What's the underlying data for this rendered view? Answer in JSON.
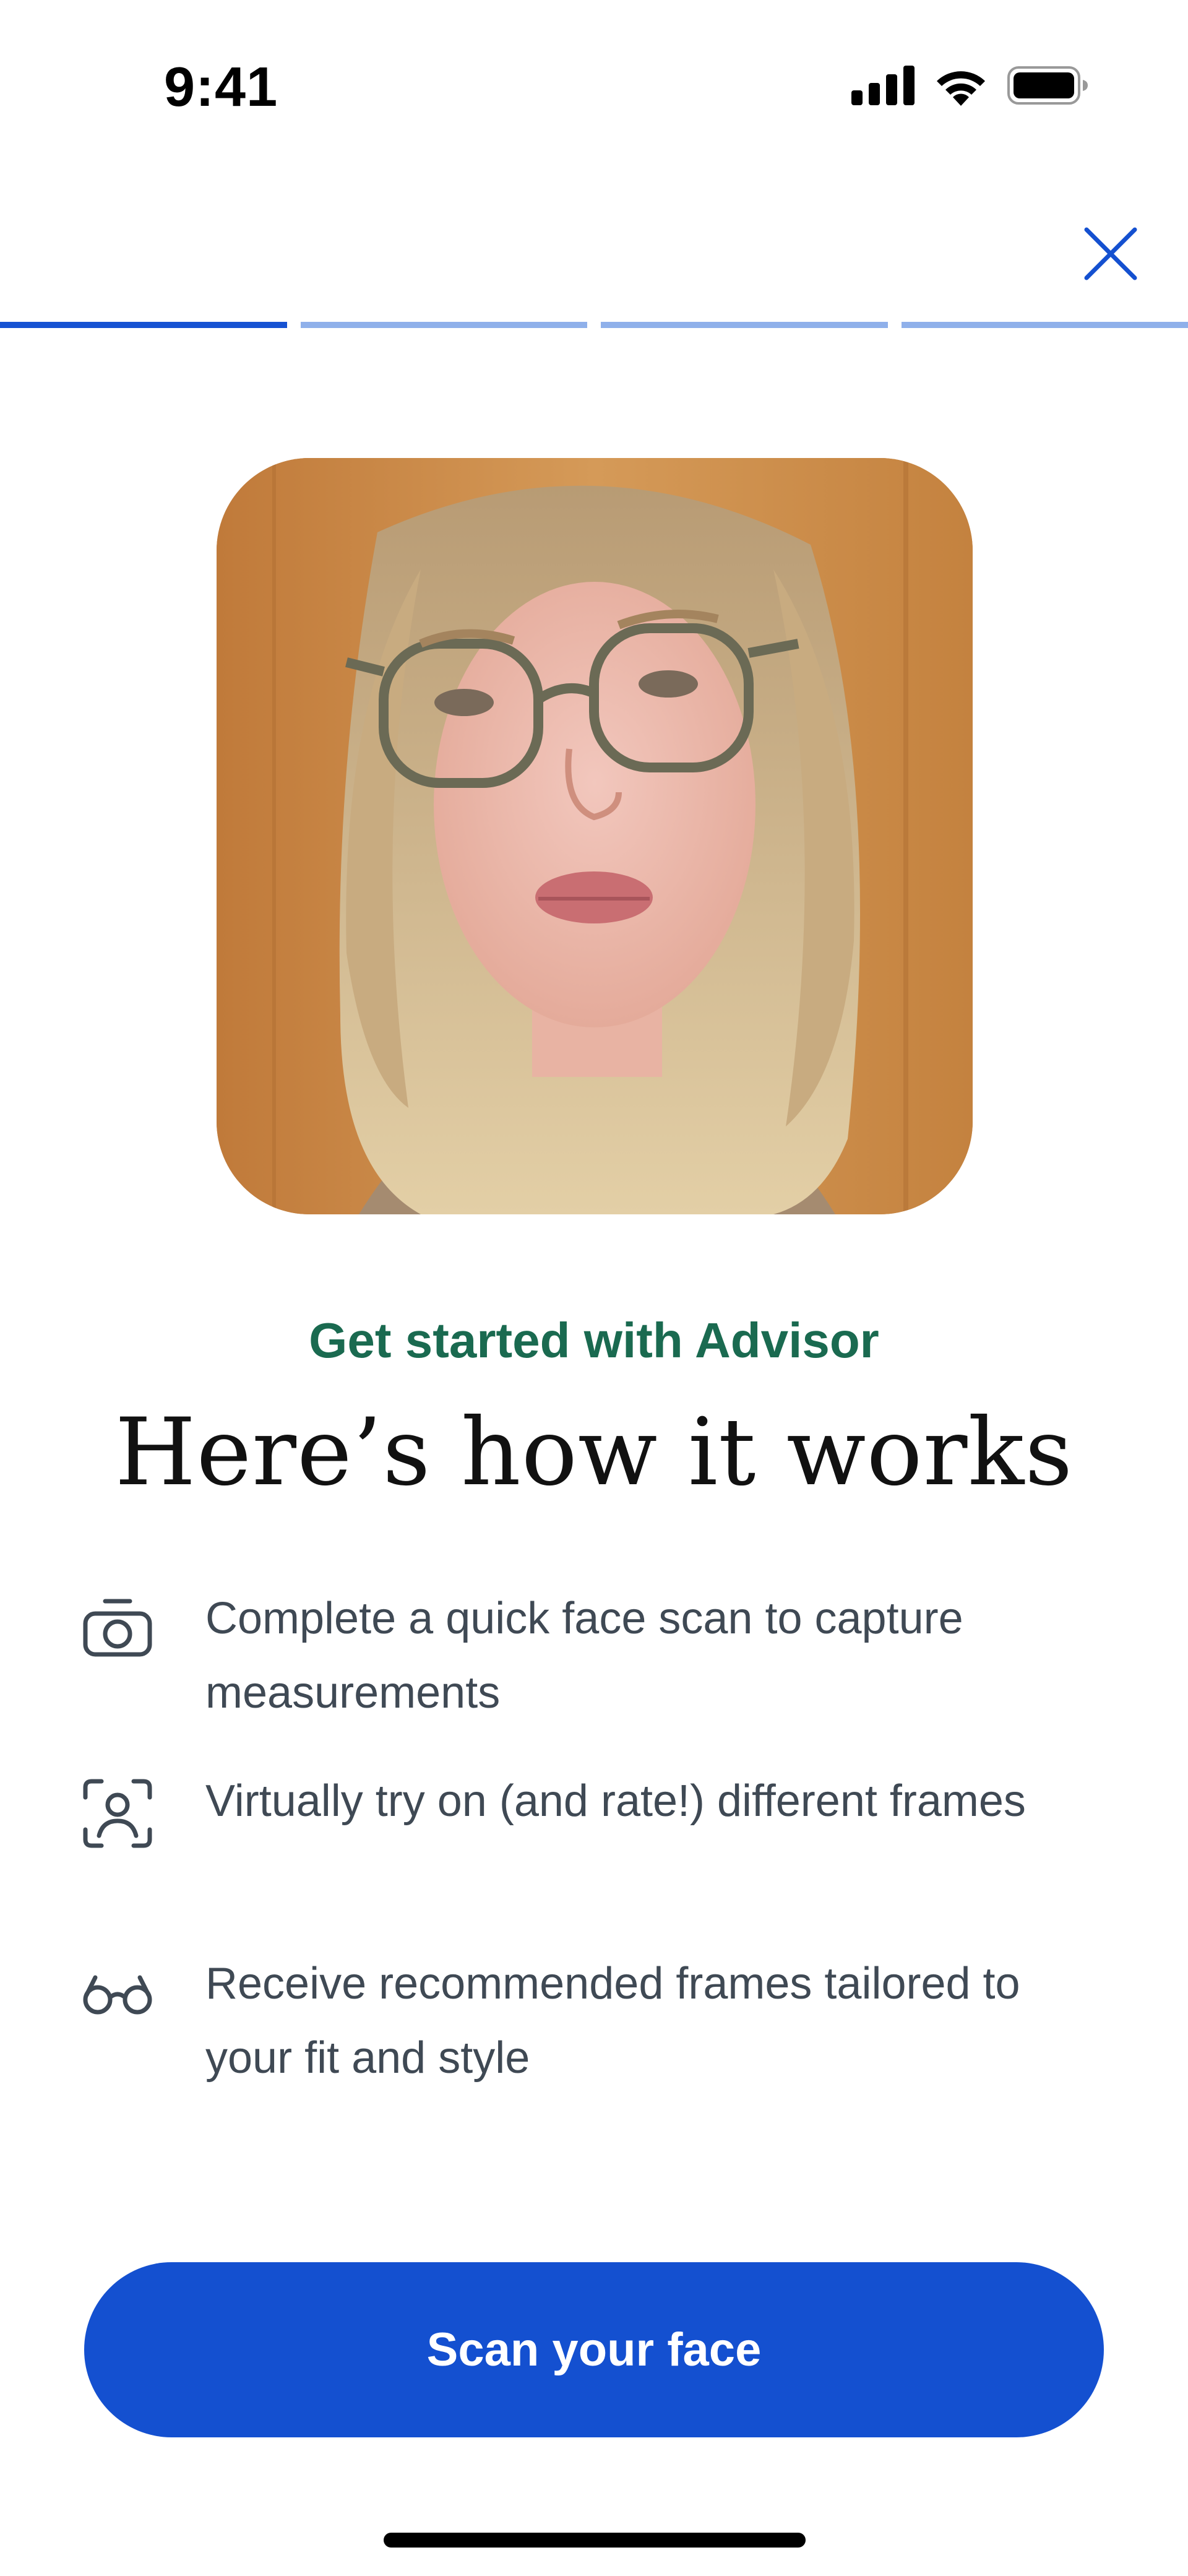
{
  "status_bar": {
    "time": "9:41",
    "icons": [
      "cellular-signal-icon",
      "wifi-icon",
      "battery-icon"
    ]
  },
  "header": {
    "close_icon": "close-icon",
    "progress": {
      "total_steps": 4,
      "current_step": 1
    }
  },
  "hero": {
    "image_description_name": "face-photo"
  },
  "content": {
    "eyebrow": "Get started with Advisor",
    "headline": "Here’s how it works",
    "steps": [
      {
        "icon": "camera-icon",
        "text": "Complete a quick face scan to capture measurements"
      },
      {
        "icon": "face-scan-icon",
        "text": "Virtually try on (and rate!) different frames"
      },
      {
        "icon": "glasses-icon",
        "text": "Receive recommended frames tailored to your fit and style"
      }
    ]
  },
  "cta": {
    "label": "Scan your face"
  },
  "colors": {
    "accent": "#1450d0",
    "progress_active": "#1652d2",
    "progress_inactive": "#8fb0ea",
    "eyebrow": "#1a6a50",
    "headline": "#111111",
    "body_text": "#3f4954"
  }
}
